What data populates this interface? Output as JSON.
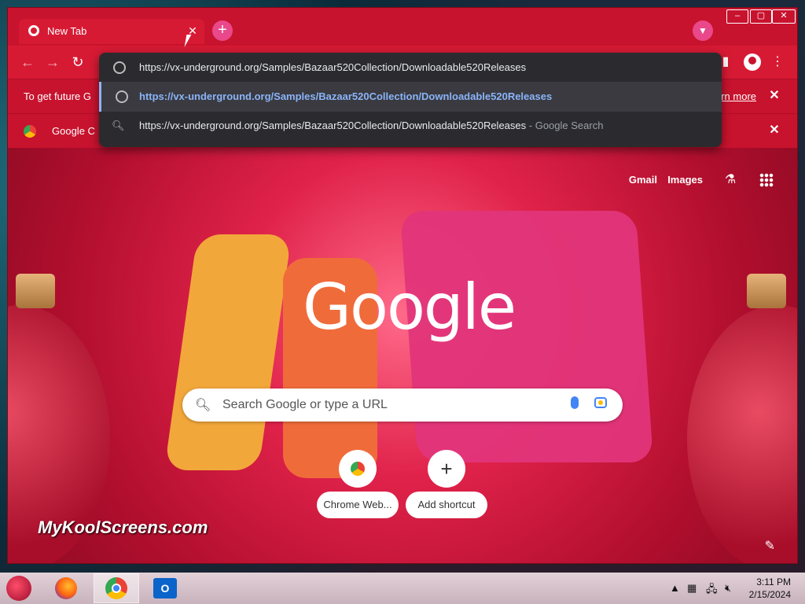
{
  "window": {
    "tab_title": "New Tab",
    "min_icon": "minimize-icon",
    "max_icon": "maximize-icon",
    "close_icon": "close-icon"
  },
  "infobar": {
    "text": "To get future G",
    "learn_more": "earn more"
  },
  "infobar2": {
    "text": "Google C"
  },
  "omnibox": {
    "input_value": "https://vx-underground.org/Samples/Bazaar520Collection/Downloadable520Releases",
    "suggestions": [
      {
        "text": "https://vx-underground.org/Samples/Bazaar520Collection/Downloadable520Releases",
        "icon": "globe-icon"
      },
      {
        "text": "https://vx-underground.org/Samples/Bazaar520Collection/Downloadable520Releases",
        "suffix": "- Google Search",
        "icon": "search-icon"
      }
    ]
  },
  "ntp": {
    "gmail": "Gmail",
    "images": "Images",
    "logo": "Google",
    "search_placeholder": "Search Google or type a URL",
    "shortcuts": [
      {
        "label": "Chrome Web...",
        "icon": "chrome-icon"
      },
      {
        "label": "Add shortcut",
        "icon": "plus-icon"
      }
    ]
  },
  "watermark": "MyKoolScreens.com",
  "taskbar": {
    "time": "3:11 PM",
    "date": "2/15/2024",
    "apps": [
      "firefox-icon",
      "chrome-icon",
      "outlook-icon"
    ],
    "outlook_letter": "O"
  }
}
